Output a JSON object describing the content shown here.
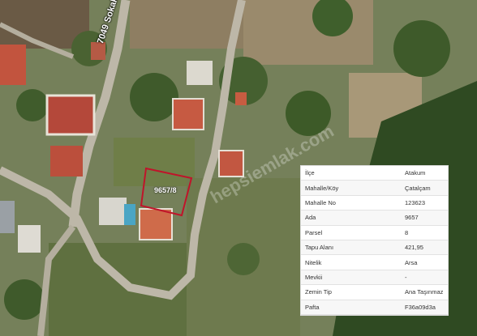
{
  "map": {
    "street_label": "7049 Sokak",
    "parcel_label": "9657/8",
    "watermark": "hepsiemlak.com"
  },
  "info": {
    "rows": [
      {
        "label": "İlçe",
        "value": "Atakum"
      },
      {
        "label": "Mahalle/Köy",
        "value": "Çatalçam"
      },
      {
        "label": "Mahalle No",
        "value": "123623"
      },
      {
        "label": "Ada",
        "value": "9657"
      },
      {
        "label": "Parsel",
        "value": "8"
      },
      {
        "label": "Tapu Alanı",
        "value": "421,95"
      },
      {
        "label": "Nitelik",
        "value": "Arsa"
      },
      {
        "label": "Mevkii",
        "value": "-"
      },
      {
        "label": "Zemin Tip",
        "value": "Ana Taşınmaz"
      },
      {
        "label": "Pafta",
        "value": "F36a09d3a"
      }
    ]
  },
  "colors": {
    "parcel_border": "#c0142a",
    "road": "#bdb7a8",
    "vegetation": "#4f6a32"
  }
}
